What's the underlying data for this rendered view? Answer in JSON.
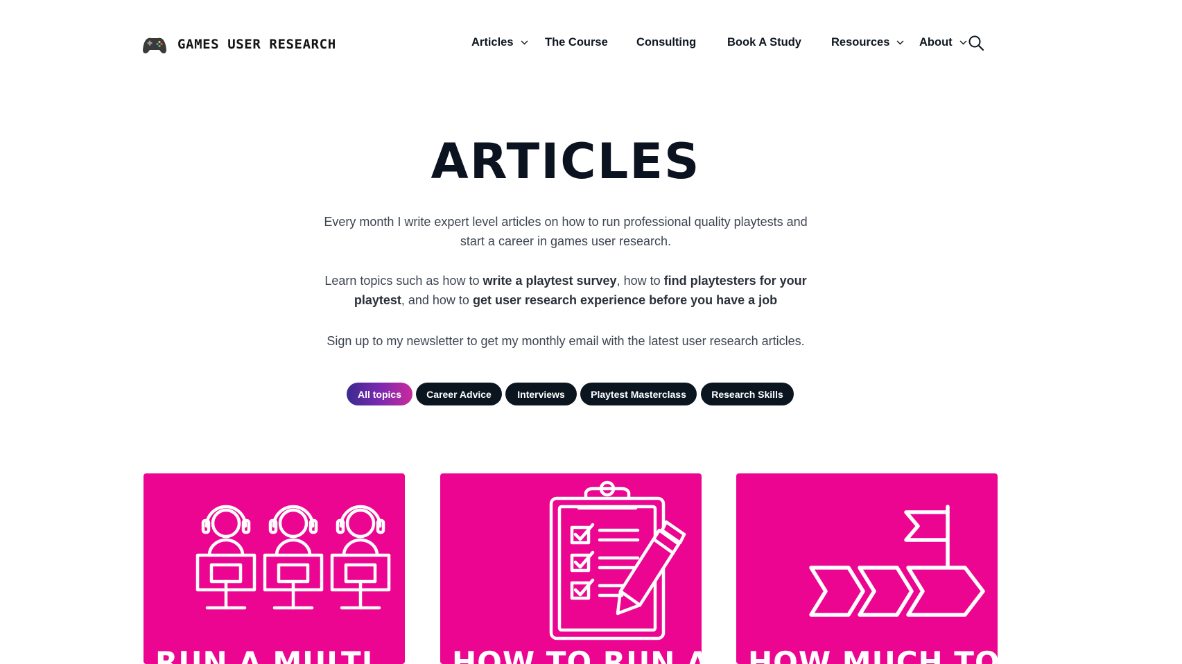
{
  "brand": {
    "logo_icon": "gamepad-icon",
    "name": "GAMES USER RESEARCH"
  },
  "nav": {
    "items": [
      {
        "label": "Articles",
        "has_dropdown": true
      },
      {
        "label": "The Course",
        "has_dropdown": false
      },
      {
        "label": "Consulting",
        "has_dropdown": false
      },
      {
        "label": "Book A Study",
        "has_dropdown": false
      },
      {
        "label": "Resources",
        "has_dropdown": true
      },
      {
        "label": "About",
        "has_dropdown": true
      }
    ],
    "search_icon": "search-icon"
  },
  "hero": {
    "title": "ARTICLES",
    "intro_line1": "Every month I write expert level articles on how to run professional quality playtests and start a career in games user research.",
    "intro_line2": {
      "t1": "Learn topics such as how to ",
      "b1": "write a playtest survey",
      "t2": ", how to ",
      "b2": "find playtesters for your playtest",
      "t3": ", and how to ",
      "b3": "get user research experience before you have a job"
    },
    "intro_line3": "Sign up to my newsletter to get my monthly email with the latest user research articles."
  },
  "filters": {
    "pills": [
      {
        "label": "All topics",
        "active": true
      },
      {
        "label": "Career Advice",
        "active": false
      },
      {
        "label": "Interviews",
        "active": false
      },
      {
        "label": "Playtest Masterclass",
        "active": false
      },
      {
        "label": "Research Skills",
        "active": false
      }
    ]
  },
  "cards": [
    {
      "title": "RUN A MULTI",
      "illustration": "players-at-monitors-icon"
    },
    {
      "title": "HOW TO RUN A",
      "illustration": "clipboard-checklist-pencil-icon"
    },
    {
      "title": "HOW MUCH TO",
      "illustration": "flag-progress-arrows-icon"
    }
  ],
  "colors": {
    "card_bg": "#ec0591",
    "pill_bg": "#0b1520",
    "pill_active_gradient": [
      "#3b2a8f",
      "#c92a9c"
    ],
    "heading": "#0c1320",
    "body_text": "#3d4451"
  }
}
